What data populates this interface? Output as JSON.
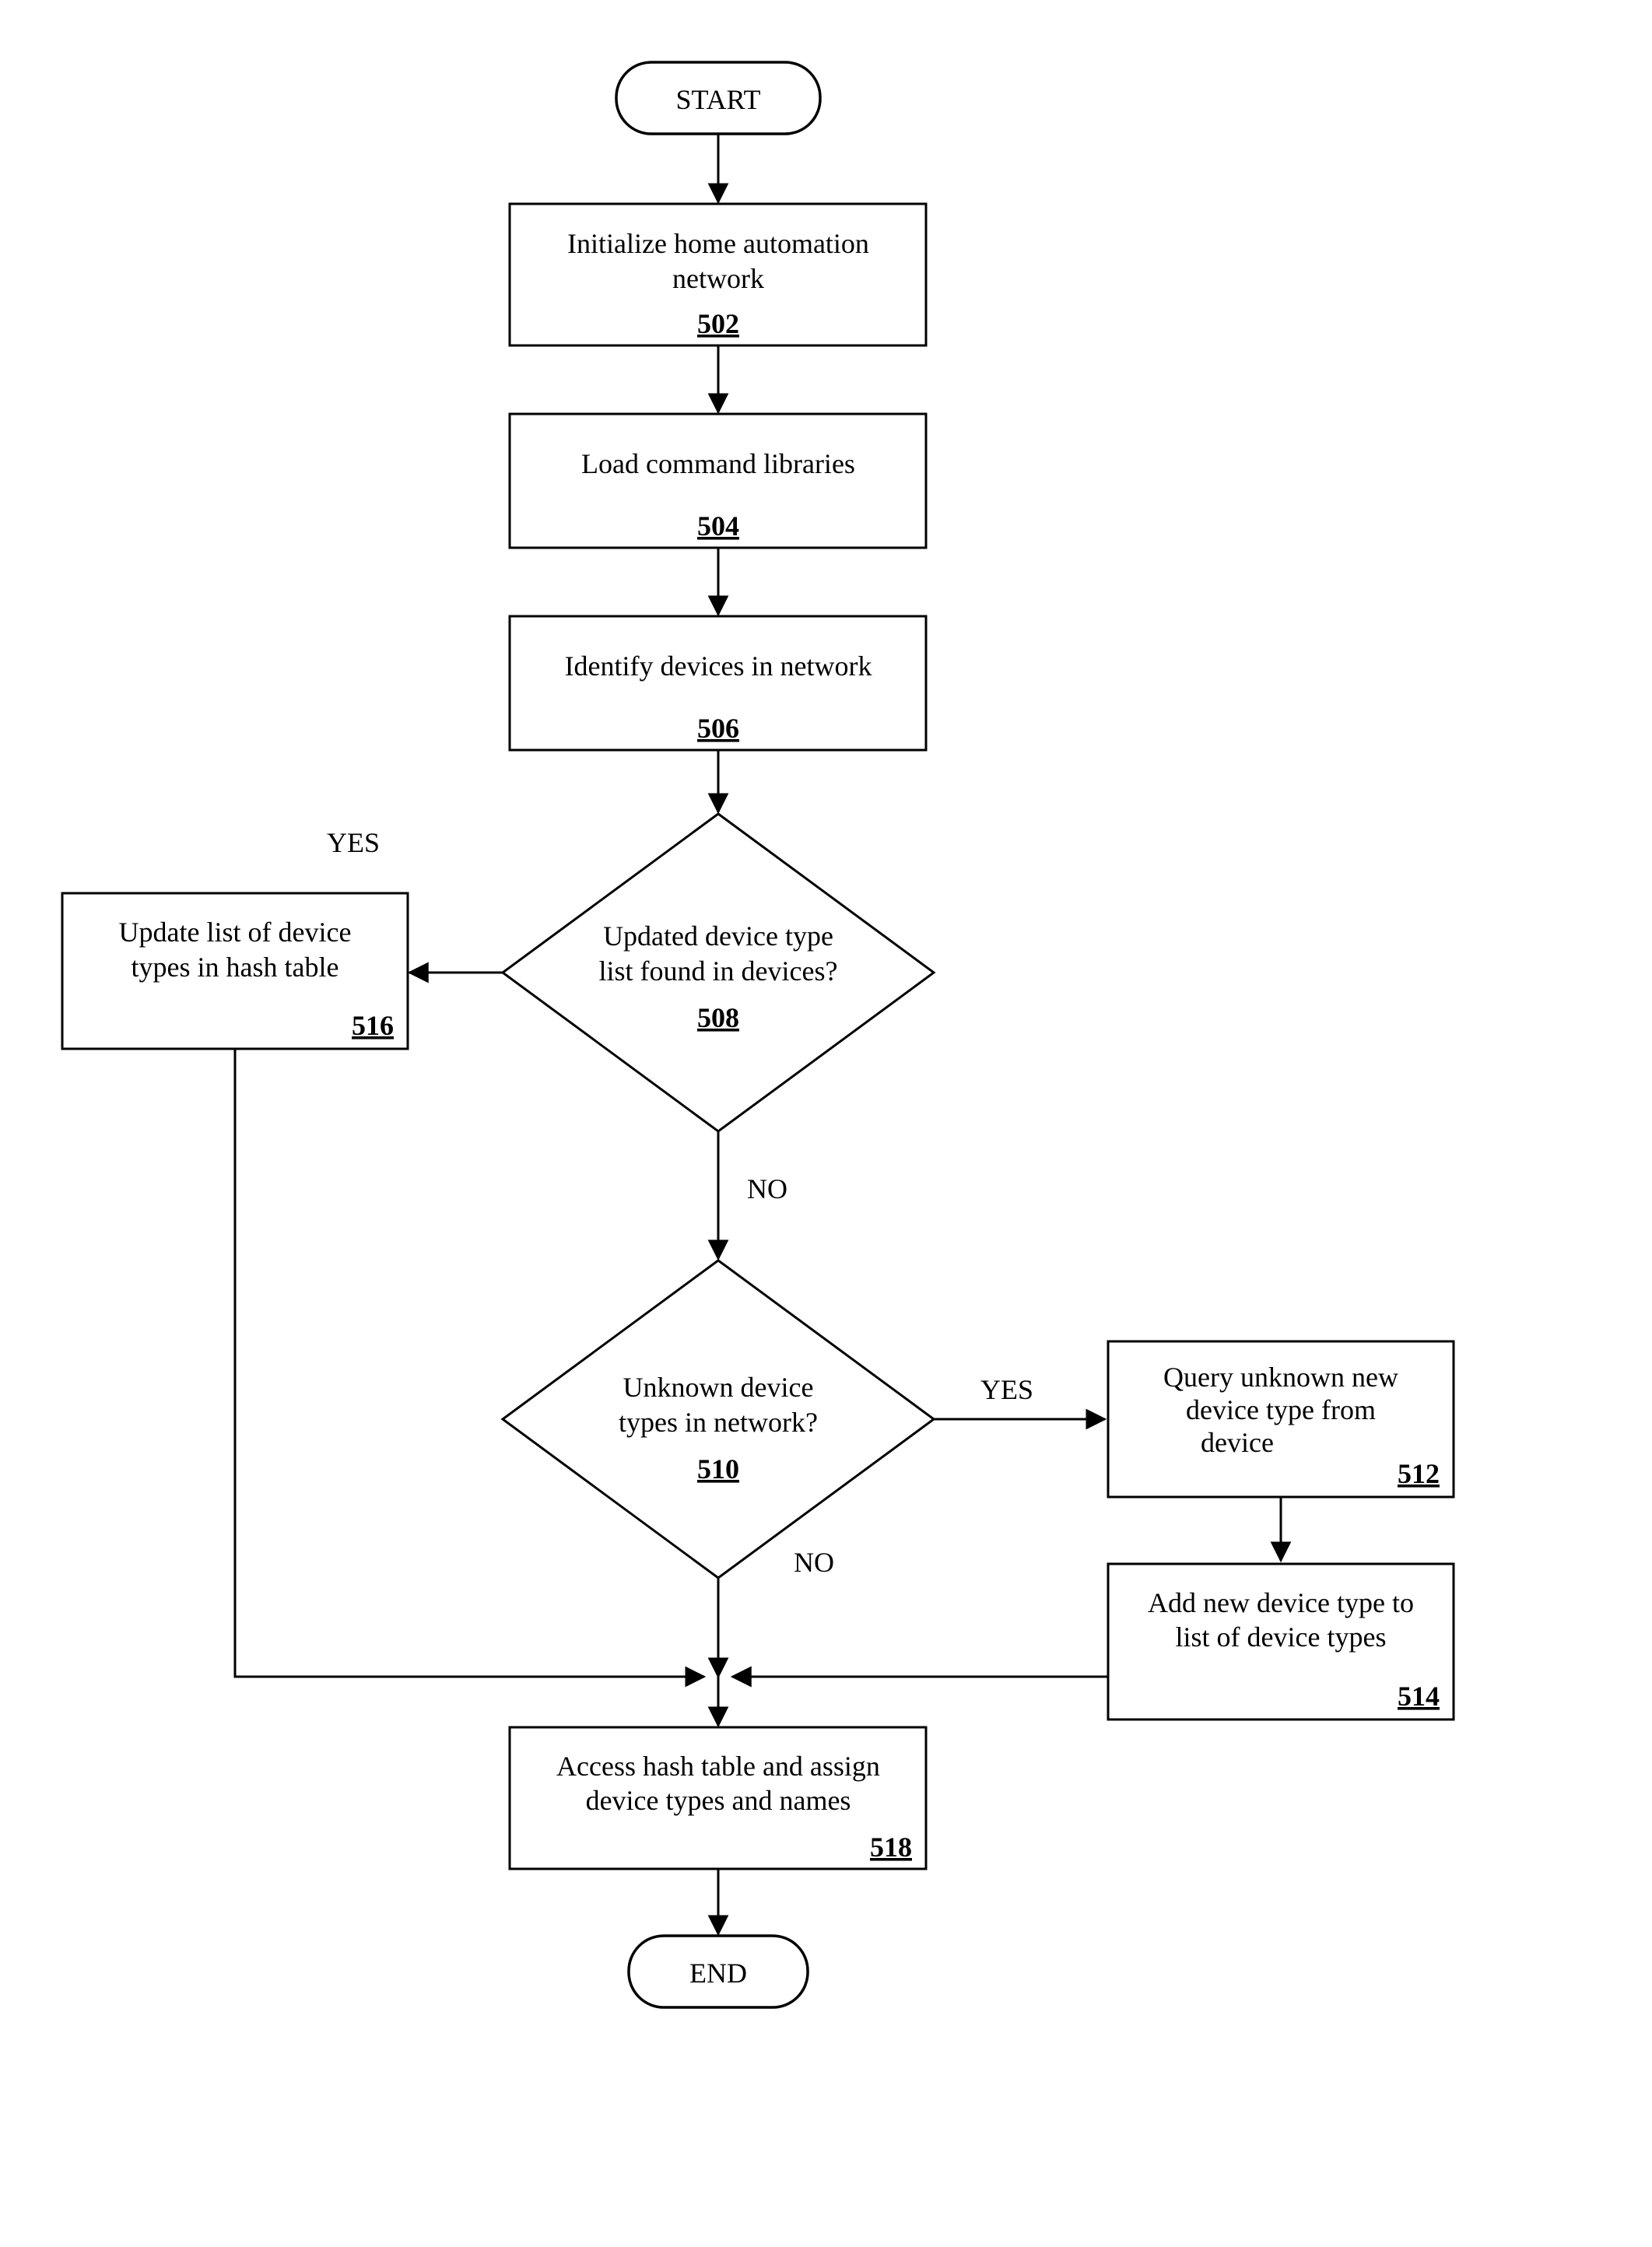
{
  "chart_data": {
    "type": "flowchart",
    "nodes": [
      {
        "id": "start",
        "kind": "terminator",
        "label": "START"
      },
      {
        "id": "n502",
        "kind": "process",
        "label": "Initialize home automation network",
        "ref": "502"
      },
      {
        "id": "n504",
        "kind": "process",
        "label": "Load command libraries",
        "ref": "504"
      },
      {
        "id": "n506",
        "kind": "process",
        "label": "Identify devices in network",
        "ref": "506"
      },
      {
        "id": "n508",
        "kind": "decision",
        "label": "Updated device type list found in devices?",
        "ref": "508"
      },
      {
        "id": "n510",
        "kind": "decision",
        "label": "Unknown device types in network?",
        "ref": "510"
      },
      {
        "id": "n512",
        "kind": "process",
        "label": "Query unknown new device type from device",
        "ref": "512"
      },
      {
        "id": "n514",
        "kind": "process",
        "label": "Add new device type to list of device types",
        "ref": "514"
      },
      {
        "id": "n516",
        "kind": "process",
        "label": "Update list of device types in hash table",
        "ref": "516"
      },
      {
        "id": "n518",
        "kind": "process",
        "label": "Access hash table and assign device types and names",
        "ref": "518"
      },
      {
        "id": "end",
        "kind": "terminator",
        "label": "END"
      }
    ],
    "edges": [
      {
        "from": "start",
        "to": "n502"
      },
      {
        "from": "n502",
        "to": "n504"
      },
      {
        "from": "n504",
        "to": "n506"
      },
      {
        "from": "n506",
        "to": "n508"
      },
      {
        "from": "n508",
        "to": "n516",
        "label": "YES"
      },
      {
        "from": "n508",
        "to": "n510",
        "label": "NO"
      },
      {
        "from": "n510",
        "to": "n512",
        "label": "YES"
      },
      {
        "from": "n510",
        "to": "n518",
        "label": "NO"
      },
      {
        "from": "n512",
        "to": "n514"
      },
      {
        "from": "n514",
        "to": "n518"
      },
      {
        "from": "n516",
        "to": "n518"
      },
      {
        "from": "n518",
        "to": "end"
      }
    ]
  },
  "labels": {
    "start": "START",
    "end": "END",
    "n502a": "Initialize home automation",
    "n502b": "network",
    "n504": "Load command libraries",
    "n506": "Identify devices in network",
    "n508a": "Updated device type",
    "n508b": "list found in devices?",
    "n510a": "Unknown device",
    "n510b": "types in network?",
    "n512a": "Query unknown new",
    "n512b": "device type from",
    "n512c": "device",
    "n514a": "Add new device type to",
    "n514b": "list of device types",
    "n516a": "Update list of device",
    "n516b": "types in hash table",
    "n518a": "Access hash table and assign",
    "n518b": "device types and names",
    "yes": "YES",
    "no": "NO"
  },
  "refs": {
    "n502": "502",
    "n504": "504",
    "n506": "506",
    "n508": "508",
    "n510": "510",
    "n512": "512",
    "n514": "514",
    "n516": "516",
    "n518": "518"
  }
}
